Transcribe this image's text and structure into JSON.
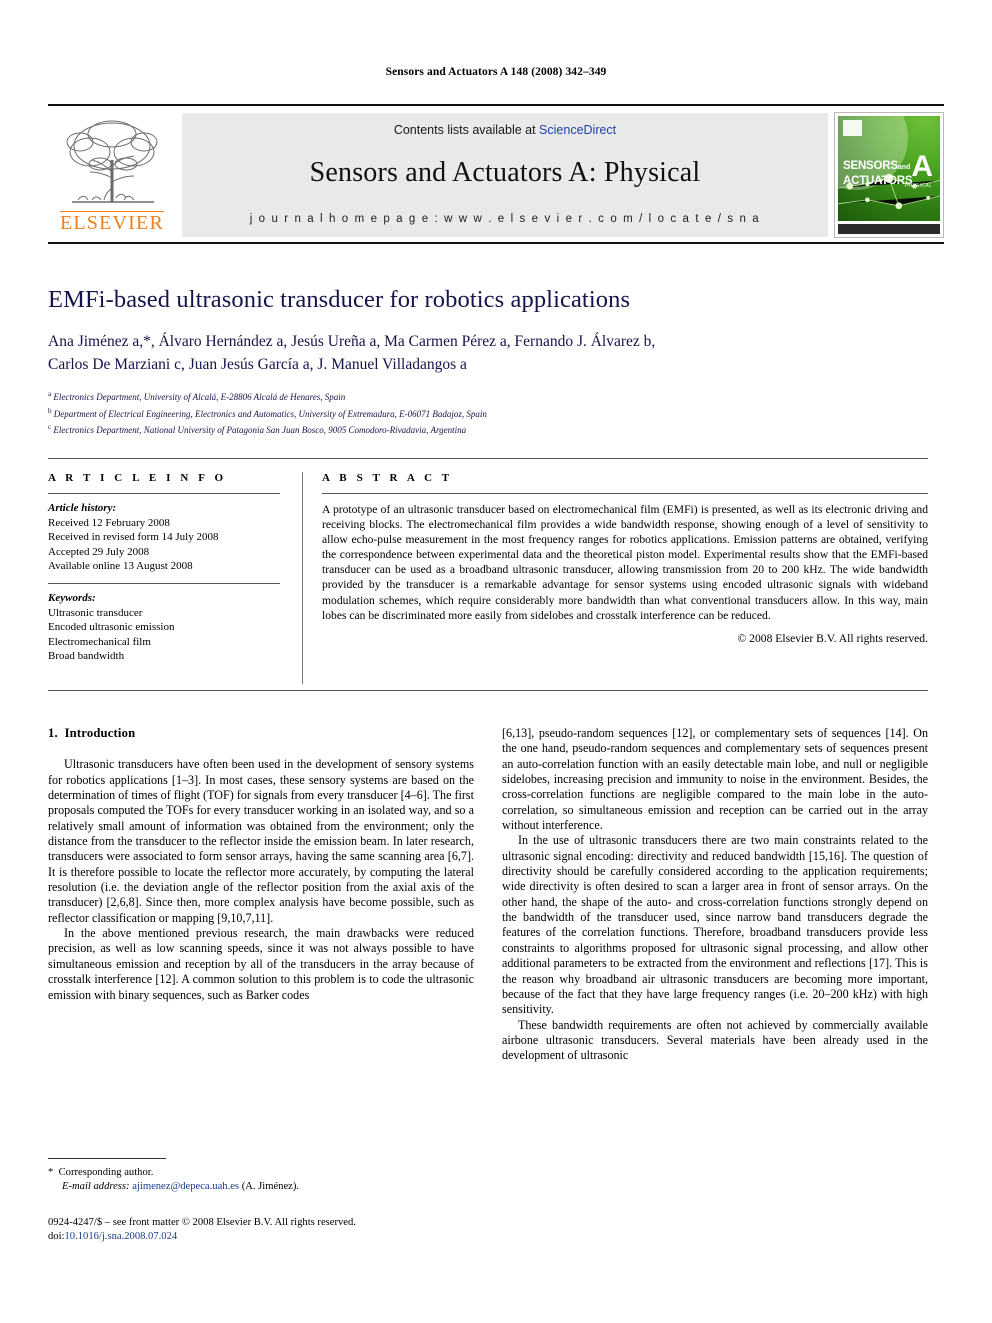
{
  "running_head": "Sensors and Actuators A 148 (2008) 342–349",
  "masthead": {
    "contents_prefix": "Contents lists available at ",
    "sciencedirect": "ScienceDirect",
    "journal_title": "Sensors and Actuators A: Physical",
    "homepage": "j o u r n a l   h o m e p a g e :   w w w . e l s e v i e r . c o m / l o c a t e / s n a",
    "publisher_wordmark": "ELSEVIER",
    "cover": {
      "line1": "SENSORS",
      "line1_small": "and",
      "line2": "ACTUATORS",
      "volume_letter": "A",
      "subtitle": "PHYSICAL"
    },
    "accent_orange": "#F07F1A",
    "link_blue": "#1f43a8"
  },
  "article": {
    "title": "EMFi-based ultrasonic transducer for robotics applications",
    "authors_line1": "Ana Jiménez a,*, Álvaro Hernández a, Jesús Ureña a, Ma Carmen Pérez a, Fernando J. Álvarez b,",
    "authors_line2": "Carlos De Marziani c, Juan Jesús García a, J. Manuel Villadangos a",
    "affiliations": [
      {
        "marker": "a",
        "text": "Electronics Department, University of Alcalá, E-28806 Alcalá de Henares, Spain"
      },
      {
        "marker": "b",
        "text": "Department of Electrical Engineering, Electronics and Automatics, University of Extremadura, E-06071 Badajoz, Spain"
      },
      {
        "marker": "c",
        "text": "Electronics Department, National University of Patagonia San Juan Bosco, 9005 Comodoro-Rivadavia, Argentina"
      }
    ]
  },
  "article_info": {
    "heading": "A R T I C L E   I N F O",
    "history_label": "Article history:",
    "history": [
      "Received 12 February 2008",
      "Received in revised form 14 July 2008",
      "Accepted 29 July 2008",
      "Available online 13 August 2008"
    ],
    "keywords_label": "Keywords:",
    "keywords": [
      "Ultrasonic transducer",
      "Encoded ultrasonic emission",
      "Electromechanical film",
      "Broad bandwidth"
    ]
  },
  "abstract": {
    "heading": "A B S T R A C T",
    "text": "A prototype of an ultrasonic transducer based on electromechanical film (EMFi) is presented, as well as its electronic driving and receiving blocks. The electromechanical film provides a wide bandwidth response, showing enough of a level of sensitivity to allow echo-pulse measurement in the most frequency ranges for robotics applications. Emission patterns are obtained, verifying the correspondence between experimental data and the theoretical piston model. Experimental results show that the EMFi-based transducer can be used as a broadband ultrasonic transducer, allowing transmission from 20 to 200 kHz. The wide bandwidth provided by the transducer is a remarkable advantage for sensor systems using encoded ultrasonic signals with wideband modulation schemes, which require considerably more bandwidth than what conventional transducers allow. In this way, main lobes can be discriminated more easily from sidelobes and crosstalk interference can be reduced.",
    "copyright": "© 2008 Elsevier B.V. All rights reserved."
  },
  "body": {
    "section_number": "1.",
    "section_title": "Introduction",
    "left_paragraphs": [
      "Ultrasonic transducers have often been used in the development of sensory systems for robotics applications [1–3]. In most cases, these sensory systems are based on the determination of times of flight (TOF) for signals from every transducer [4–6]. The first proposals computed the TOFs for every transducer working in an isolated way, and so a relatively small amount of information was obtained from the environment; only the distance from the transducer to the reflector inside the emission beam. In later research, transducers were associated to form sensor arrays, having the same scanning area [6,7]. It is therefore possible to locate the reflector more accurately, by computing the lateral resolution (i.e. the deviation angle of the reflector position from the axial axis of the transducer) [2,6,8]. Since then, more complex analysis have become possible, such as reflector classification or mapping [9,10,7,11].",
      "In the above mentioned previous research, the main drawbacks were reduced precision, as well as low scanning speeds, since it was not always possible to have simultaneous emission and reception by all of the transducers in the array because of crosstalk interference [12]. A common solution to this problem is to code the ultrasonic emission with binary sequences, such as Barker codes"
    ],
    "right_paragraphs": [
      "[6,13], pseudo-random sequences [12], or complementary sets of sequences [14]. On the one hand, pseudo-random sequences and complementary sets of sequences present an auto-correlation function with an easily detectable main lobe, and null or negligible sidelobes, increasing precision and immunity to noise in the environment. Besides, the cross-correlation functions are negligible compared to the main lobe in the auto-correlation, so simultaneous emission and reception can be carried out in the array without interference.",
      "In the use of ultrasonic transducers there are two main constraints related to the ultrasonic signal encoding: directivity and reduced bandwidth [15,16]. The question of directivity should be carefully considered according to the application requirements; wide directivity is often desired to scan a larger area in front of sensor arrays. On the other hand, the shape of the auto- and cross-correlation functions strongly depend on the bandwidth of the transducer used, since narrow band transducers degrade the features of the correlation functions. Therefore, broadband transducers provide less constraints to algorithms proposed for ultrasonic signal processing, and allow other additional parameters to be extracted from the environment and reflections [17]. This is the reason why broadband air ultrasonic transducers are becoming more important, because of the fact that they have large frequency ranges (i.e. 20–200 kHz) with high sensitivity.",
      "These bandwidth requirements are often not achieved by commercially available airbone ultrasonic transducers. Several materials have been already used in the development of ultrasonic"
    ]
  },
  "footnote": {
    "star": "*",
    "corresponding": "Corresponding author.",
    "email_label": "E-mail address:",
    "email": "ajimenez@depeca.uah.es",
    "email_owner": "(A. Jiménez)."
  },
  "footer": {
    "front_matter": "0924-4247/$ – see front matter © 2008 Elsevier B.V. All rights reserved.",
    "doi_label": "doi:",
    "doi": "10.1016/j.sna.2008.07.024"
  }
}
